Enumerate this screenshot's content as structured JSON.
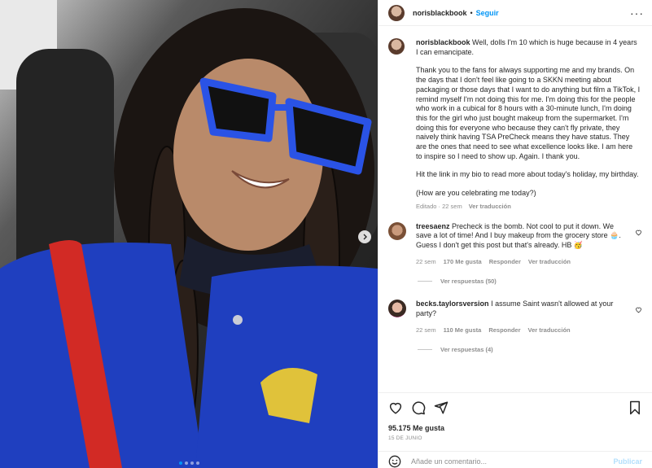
{
  "colors": {
    "accent": "#0095f6",
    "muted": "#8e8e8e",
    "jacket": "#1f3fbf",
    "glasses": "#2a53e6"
  },
  "post": {
    "username": "norisblackbook",
    "separator": "•",
    "follow_label": "Seguir",
    "more_label": "···"
  },
  "caption": {
    "username": "norisblackbook",
    "paragraphs": [
      "Well, dolls I'm 10 which is huge because in 4 years I can emancipate.",
      "Thank you to the fans for always supporting me and my brands. On the days that I don't feel like going to a SKKN meeting about packaging or those days that I want to do anything but film a TikTok, I remind myself I'm not doing this for me. I'm doing this for the people who work in a cubical for 8 hours with a 30-minute lunch, I'm doing this for the girl who just bought makeup from the supermarket. I'm doing this for everyone who because they can't fly private, they naively think having TSA PreCheck means they have status. They are the ones that need to see what excellence looks like. I am here to inspire so I need to show up. Again. I thank you.",
      "Hit the link in my bio to read more about today's holiday, my birthday.",
      "(How are you celebrating me today?)"
    ],
    "edited": "Editado · 22 sem",
    "translate": "Ver traducción"
  },
  "comments": [
    {
      "username": "treesaenz",
      "text": "Precheck is the bomb. Not cool to put it down. We save a lot of time! And I buy makeup from the grocery store 🧁. Guess I don't get this post but that's already. HB 🥳",
      "time": "22 sem",
      "likes": "170 Me gusta",
      "reply": "Responder",
      "translate": "Ver traducción",
      "replies": "Ver respuestas (50)"
    },
    {
      "username": "becks.taylorsversion",
      "text": "I assume Saint wasn't allowed at your party?",
      "time": "22 sem",
      "likes": "110 Me gusta",
      "reply": "Responder",
      "translate": "Ver traducción",
      "replies": "Ver respuestas (4)"
    }
  ],
  "footer": {
    "likes": "95.175 Me gusta",
    "date": "15 DE JUNIO",
    "comment_placeholder": "Añade un comentario...",
    "publish_label": "Publicar"
  },
  "icons": [
    "heart-icon",
    "comment-icon",
    "share-icon",
    "bookmark-icon",
    "emoji-icon",
    "chevron-right-icon",
    "more-icon"
  ]
}
